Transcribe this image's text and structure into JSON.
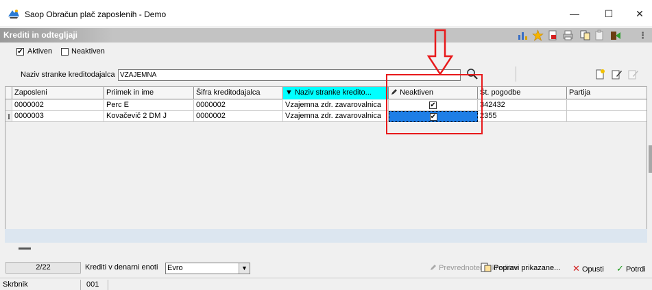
{
  "window": {
    "title": "Saop Obračun plač zaposlenih - Demo",
    "minimize": "—",
    "maximize": "☐",
    "close": "✕"
  },
  "section": {
    "title": "Krediti in odtegljaji"
  },
  "filters": {
    "aktiven_label": "Aktiven",
    "aktiven_checked": true,
    "neaktiven_label": "Neaktiven",
    "neaktiven_checked": false
  },
  "search": {
    "label": "Naziv stranke kreditodajalca",
    "value": "VZAJEMNA"
  },
  "grid": {
    "columns": [
      "Zaposleni",
      "Priimek in ime",
      "Šifra kreditodajalca",
      "▼ Naziv stranke kredito...",
      "Neaktiven",
      "Št. pogodbe",
      "Partija"
    ],
    "rows": [
      {
        "zaposleni": "0000002",
        "priimek": "Perc E",
        "sifra": "0000002",
        "naziv": "Vzajemna zdr. zavarovalnica",
        "neaktiven": "✔",
        "pogodbe": "342432",
        "partija": ""
      },
      {
        "zaposleni": "0000003",
        "priimek": "Kovačevič 2 DM J",
        "sifra": "0000002",
        "naziv": "Vzajemna zdr. zavarovalnica",
        "neaktiven": "✔",
        "pogodbe": "2355",
        "partija": ""
      }
    ],
    "row_indicator": "I"
  },
  "footer": {
    "count": "2/22",
    "currency_label": "Krediti v denarni enoti",
    "currency_value": "Evro",
    "prevrednotenje": "Prevrednotenje kreditov",
    "popravi": "Popravi prikazane...",
    "opusti": "Opusti",
    "potrdi": "Potrdi"
  },
  "status": {
    "user": "Skrbnik",
    "code": "001"
  },
  "colors": {
    "sorted_header": "#00ffff",
    "selection": "#1e7ee6",
    "annotation": "#e8191b"
  }
}
